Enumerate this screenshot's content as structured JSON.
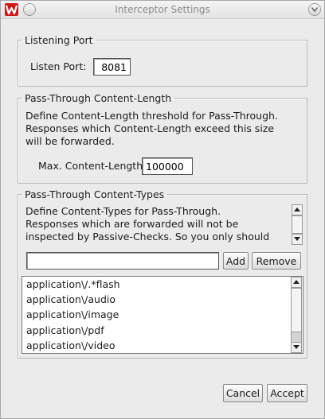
{
  "window": {
    "title": "Interceptor Settings"
  },
  "listening_port": {
    "legend": "Listening Port",
    "label": "Listen Port:",
    "value": "8081"
  },
  "content_length": {
    "legend": "Pass-Through Content-Length",
    "description": "Define Content-Length threshold for Pass-Through.\nResponses which Content-Length exceed this size\nwill be forwarded.",
    "label": "Max. Content-Length:",
    "value": "100000"
  },
  "content_types": {
    "legend": "Pass-Through Content-Types",
    "description": "Define Content-Types for Pass-Through.\nResponses which are forwarded will not be\ninspected by Passive-Checks. So you only should",
    "new_type_value": "",
    "add_label": "Add",
    "remove_label": "Remove",
    "items": [
      "application\\/.*flash",
      "application\\/audio",
      "application\\/image",
      "application\\/pdf",
      "application\\/video"
    ]
  },
  "footer": {
    "cancel_label": "Cancel",
    "accept_label": "Accept"
  },
  "icons": {
    "app": "watobo-app-icon",
    "minimize": "minimize-icon",
    "close": "close-icon"
  },
  "colors": {
    "window_bg": "#ebebeb",
    "app_icon_red": "#d01818"
  }
}
